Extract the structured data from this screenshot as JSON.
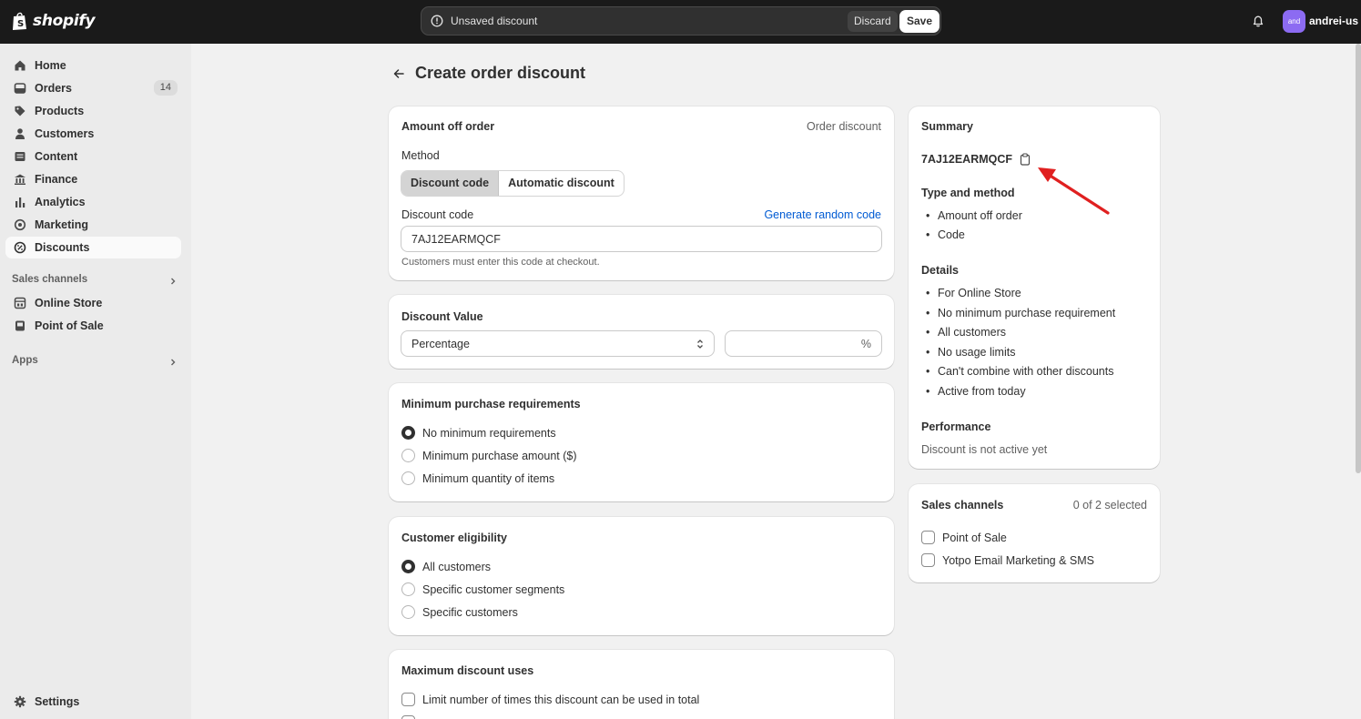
{
  "topbar": {
    "brand": "shopify",
    "unsaved_message": "Unsaved discount",
    "discard_label": "Discard",
    "save_label": "Save",
    "avatar_initials": "and",
    "username": "andrei-us"
  },
  "sidebar": {
    "items": [
      {
        "label": "Home",
        "icon": "home-icon"
      },
      {
        "label": "Orders",
        "icon": "orders-icon",
        "count": "14"
      },
      {
        "label": "Products",
        "icon": "tag-icon"
      },
      {
        "label": "Customers",
        "icon": "person-icon"
      },
      {
        "label": "Content",
        "icon": "content-icon"
      },
      {
        "label": "Finance",
        "icon": "bank-icon"
      },
      {
        "label": "Analytics",
        "icon": "bar-chart-icon"
      },
      {
        "label": "Marketing",
        "icon": "target-icon"
      },
      {
        "label": "Discounts",
        "icon": "discount-icon",
        "active": true
      }
    ],
    "sales_channels_label": "Sales channels",
    "channels": [
      {
        "label": "Online Store",
        "icon": "store-icon"
      },
      {
        "label": "Point of Sale",
        "icon": "pos-icon"
      }
    ],
    "apps_label": "Apps",
    "settings_label": "Settings"
  },
  "page": {
    "title": "Create order discount"
  },
  "method_card": {
    "title": "Amount off order",
    "subtitle": "Order discount",
    "method_label": "Method",
    "method_options": [
      "Discount code",
      "Automatic discount"
    ],
    "selected_method": "Discount code",
    "code_label": "Discount code",
    "generate_link": "Generate random code",
    "code_value": "7AJ12EARMQCF",
    "code_help": "Customers must enter this code at checkout."
  },
  "value_card": {
    "title": "Discount Value",
    "type_value": "Percentage",
    "amount_value": "",
    "suffix": "%"
  },
  "min_card": {
    "title": "Minimum purchase requirements",
    "options": [
      "No minimum requirements",
      "Minimum purchase amount ($)",
      "Minimum quantity of items"
    ],
    "selected": 0
  },
  "eligibility_card": {
    "title": "Customer eligibility",
    "options": [
      "All customers",
      "Specific customer segments",
      "Specific customers"
    ],
    "selected": 0
  },
  "max_uses_card": {
    "title": "Maximum discount uses",
    "options": [
      "Limit number of times this discount can be used in total"
    ]
  },
  "summary": {
    "title": "Summary",
    "code": "7AJ12EARMQCF",
    "type_heading": "Type and method",
    "type_items": [
      "Amount off order",
      "Code"
    ],
    "details_heading": "Details",
    "details_items": [
      "For Online Store",
      "No minimum purchase requirement",
      "All customers",
      "No usage limits",
      "Can't combine with other discounts",
      "Active from today"
    ],
    "performance_heading": "Performance",
    "performance_text": "Discount is not active yet"
  },
  "channels_card": {
    "title": "Sales channels",
    "selected_count": "0 of 2 selected",
    "options": [
      "Point of Sale",
      "Yotpo Email Marketing & SMS"
    ]
  },
  "colors": {
    "annotation_arrow": "#e02020",
    "accent_link": "#005bd3",
    "avatar": "#8c6bf2"
  }
}
